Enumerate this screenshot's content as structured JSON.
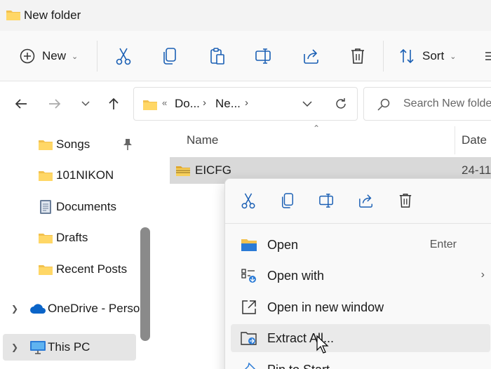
{
  "window": {
    "title": "New folder"
  },
  "toolbar": {
    "new_label": "New",
    "sort_label": "Sort",
    "actions": [
      "cut-icon",
      "copy-icon",
      "paste-icon",
      "rename-icon",
      "share-icon",
      "delete-icon"
    ],
    "accent": "#1a5fb4"
  },
  "address": {
    "lead": "«",
    "crumbs": [
      "Do...",
      "Ne..."
    ]
  },
  "search": {
    "placeholder": "Search New folder"
  },
  "sidebar": {
    "items": [
      {
        "label": "Songs",
        "icon": "folder-icon",
        "pinned": true
      },
      {
        "label": "101NIKON",
        "icon": "folder-icon"
      },
      {
        "label": "Documents",
        "icon": "documents-icon"
      },
      {
        "label": "Drafts",
        "icon": "folder-icon"
      },
      {
        "label": "Recent Posts",
        "icon": "folder-icon"
      },
      {
        "label": "OneDrive - Perso",
        "icon": "onedrive-icon",
        "expandable": true
      },
      {
        "label": "This PC",
        "icon": "pc-icon",
        "expandable": true,
        "selected": true
      }
    ]
  },
  "list": {
    "columns": [
      "Name",
      "Date"
    ],
    "rows": [
      {
        "name": "EICFG",
        "date": "24-11"
      }
    ]
  },
  "context_menu": {
    "actions": [
      "cut-icon",
      "copy-icon",
      "rename-icon",
      "share-icon",
      "delete-icon"
    ],
    "items": [
      {
        "label": "Open",
        "shortcut": "Enter"
      },
      {
        "label": "Open with",
        "submenu": true
      },
      {
        "label": "Open in new window"
      },
      {
        "label": "Extract All..."
      },
      {
        "label": "Pin to Start"
      }
    ]
  },
  "colors": {
    "folder": "#f2c14e",
    "selection": "#d9d9d9",
    "hover": "#eaeaea"
  }
}
